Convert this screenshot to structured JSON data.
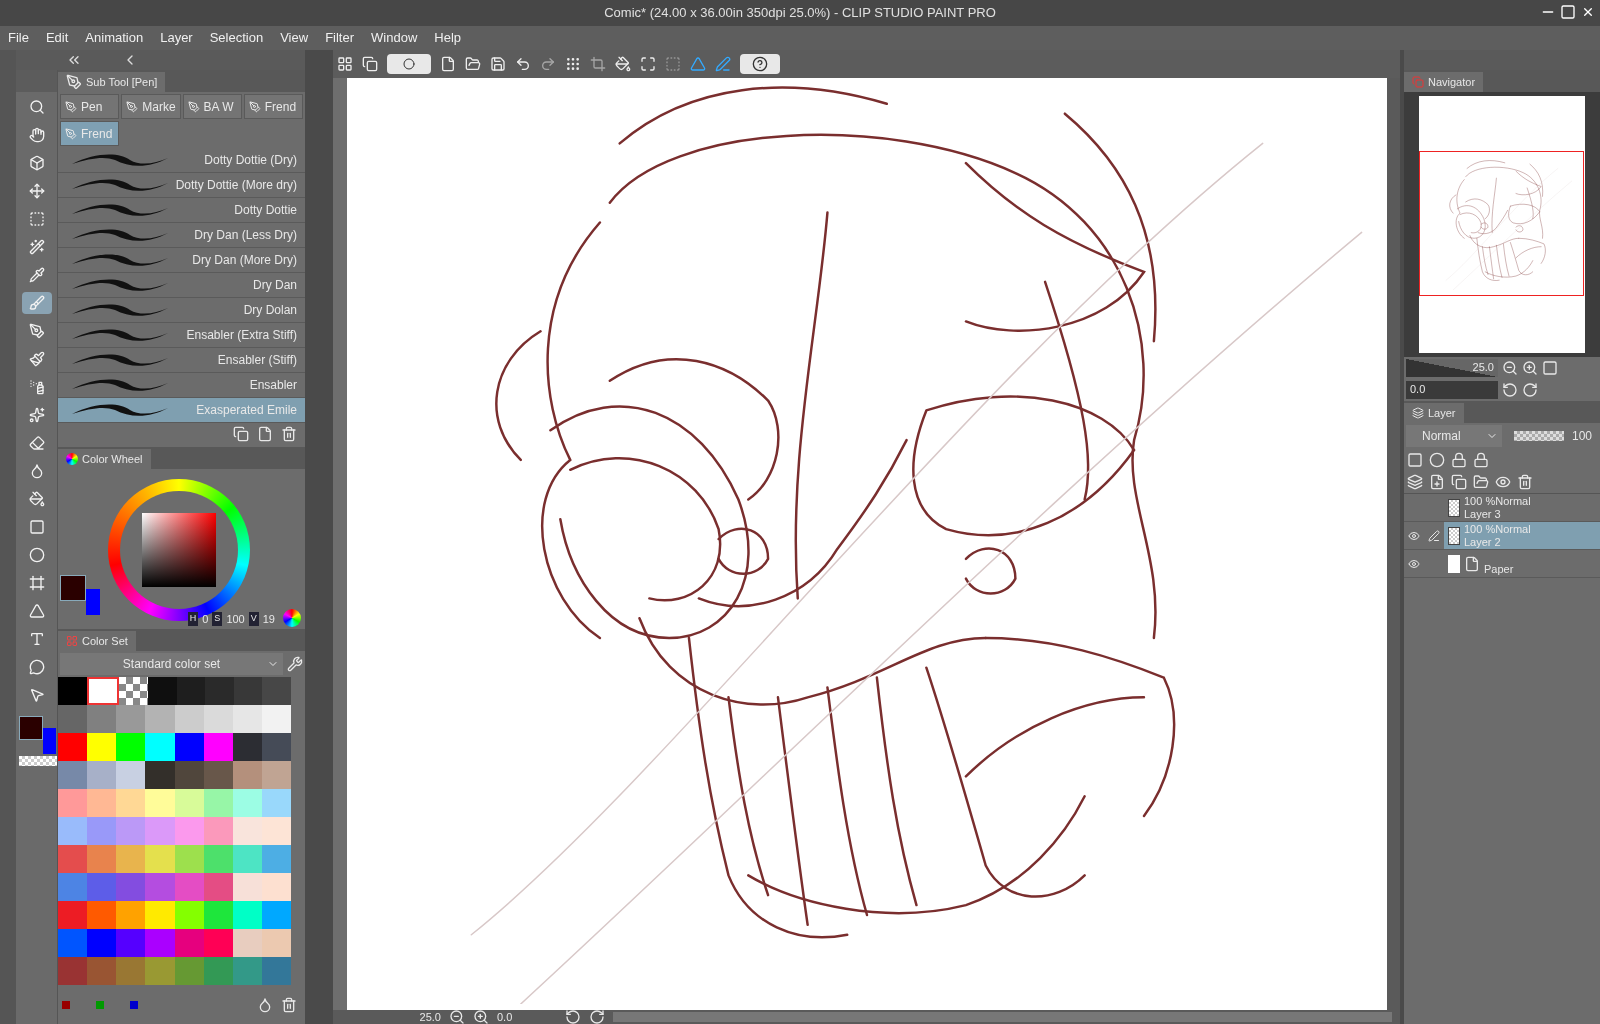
{
  "window": {
    "title": "Comic* (24.00 x 36.00in 350dpi 25.0%)  - CLIP STUDIO PAINT PRO"
  },
  "menu": [
    "File",
    "Edit",
    "Animation",
    "Layer",
    "Selection",
    "View",
    "Filter",
    "Window",
    "Help"
  ],
  "tools": [
    {
      "selected": false
    },
    {
      "selected": false
    },
    {
      "selected": false
    },
    {
      "selected": false
    },
    {
      "selected": false
    },
    {
      "selected": false
    },
    {
      "selected": false
    },
    {
      "selected": true
    },
    {
      "selected": false
    },
    {
      "selected": false
    },
    {
      "selected": false
    },
    {
      "selected": false
    },
    {
      "selected": false
    },
    {
      "selected": false
    },
    {
      "selected": false
    },
    {
      "selected": false
    },
    {
      "selected": false
    },
    {
      "selected": false
    },
    {
      "selected": false
    },
    {
      "selected": false
    },
    {
      "selected": false
    },
    {
      "selected": false
    }
  ],
  "sub_tool": {
    "title": "Sub Tool [Pen]",
    "groups": [
      {
        "label": "Pen",
        "selected": false
      },
      {
        "label": "Marke",
        "selected": false
      },
      {
        "label": "BA W",
        "selected": false
      },
      {
        "label": "Frend",
        "selected": false
      },
      {
        "label": "Frend",
        "selected": true
      }
    ],
    "brushes": [
      {
        "name": "Dotty Dottie (Dry)",
        "selected": false
      },
      {
        "name": "Dotty Dottie (More dry)",
        "selected": false
      },
      {
        "name": "Dotty Dottie",
        "selected": false
      },
      {
        "name": "Dry Dan (Less Dry)",
        "selected": false
      },
      {
        "name": "Dry Dan (More Dry)",
        "selected": false
      },
      {
        "name": "Dry Dan",
        "selected": false
      },
      {
        "name": "Dry Dolan",
        "selected": false
      },
      {
        "name": "Ensabler (Extra Stiff)",
        "selected": false
      },
      {
        "name": "Ensabler (Stiff)",
        "selected": false
      },
      {
        "name": "Ensabler",
        "selected": false
      },
      {
        "name": "Exasperated Emile",
        "selected": true
      }
    ]
  },
  "color_wheel": {
    "title": "Color Wheel",
    "h_label": "H",
    "h": "0",
    "s_label": "S",
    "s": "100",
    "v_label": "V",
    "v": "19"
  },
  "color_set": {
    "title": "Color Set",
    "set_name": "Standard color set",
    "swatches": [
      [
        {
          "color": "#000000",
          "selected": false
        },
        {
          "color": "#ffffff",
          "selected": true
        },
        {
          "kind": "transparent",
          "selected": false
        },
        {
          "color": "#0f0f0f",
          "selected": false
        },
        {
          "color": "#1e1e1e",
          "selected": false
        },
        {
          "color": "#2a2a2a",
          "selected": false
        },
        {
          "color": "#383838",
          "selected": false
        },
        {
          "color": "#474747",
          "selected": false
        }
      ],
      [
        {
          "color": "#666666",
          "selected": false
        },
        {
          "color": "#808080",
          "selected": false
        },
        {
          "color": "#999999",
          "selected": false
        },
        {
          "color": "#b3b3b3",
          "selected": false
        },
        {
          "color": "#cccccc",
          "selected": false
        },
        {
          "color": "#dadada",
          "selected": false
        },
        {
          "color": "#e6e6e6",
          "selected": false
        },
        {
          "color": "#f2f2f2",
          "selected": false
        }
      ],
      [
        {
          "color": "#ff0000",
          "selected": false
        },
        {
          "color": "#ffff00",
          "selected": false
        },
        {
          "color": "#00ff00",
          "selected": false
        },
        {
          "color": "#00ffff",
          "selected": false
        },
        {
          "color": "#0000ff",
          "selected": false
        },
        {
          "color": "#ff00ff",
          "selected": false
        },
        {
          "color": "#2c2d33",
          "selected": false
        },
        {
          "color": "#454b57",
          "selected": false
        }
      ],
      [
        {
          "color": "#7789a8",
          "selected": false
        },
        {
          "color": "#a7b0c8",
          "selected": false
        },
        {
          "color": "#c8d0e2",
          "selected": false
        },
        {
          "color": "#332f2a",
          "selected": false
        },
        {
          "color": "#50463c",
          "selected": false
        },
        {
          "color": "#68574a",
          "selected": false
        },
        {
          "color": "#b4907c",
          "selected": false
        },
        {
          "color": "#c0a493",
          "selected": false
        }
      ],
      [
        {
          "color": "#ff9999",
          "selected": false
        },
        {
          "color": "#ffb894",
          "selected": false
        },
        {
          "color": "#ffd895",
          "selected": false
        },
        {
          "color": "#fffc99",
          "selected": false
        },
        {
          "color": "#d8fb99",
          "selected": false
        },
        {
          "color": "#97f6a7",
          "selected": false
        },
        {
          "color": "#9cfde4",
          "selected": false
        },
        {
          "color": "#99d8fb",
          "selected": false
        }
      ],
      [
        {
          "color": "#99bbfb",
          "selected": false
        },
        {
          "color": "#9999f9",
          "selected": false
        },
        {
          "color": "#bb99f7",
          "selected": false
        },
        {
          "color": "#db99f9",
          "selected": false
        },
        {
          "color": "#fb99ed",
          "selected": false
        },
        {
          "color": "#fb99bb",
          "selected": false
        },
        {
          "color": "#f9e4dc",
          "selected": false
        },
        {
          "color": "#fde4d6",
          "selected": false
        }
      ],
      [
        {
          "color": "#e44d4d",
          "selected": false
        },
        {
          "color": "#e8834d",
          "selected": false
        },
        {
          "color": "#e8b44d",
          "selected": false
        },
        {
          "color": "#e4e04d",
          "selected": false
        },
        {
          "color": "#9de04d",
          "selected": false
        },
        {
          "color": "#4de06b",
          "selected": false
        },
        {
          "color": "#4de4c4",
          "selected": false
        },
        {
          "color": "#4daee4",
          "selected": false
        }
      ],
      [
        {
          "color": "#4d84e4",
          "selected": false
        },
        {
          "color": "#5d5de8",
          "selected": false
        },
        {
          "color": "#834de0",
          "selected": false
        },
        {
          "color": "#b44de0",
          "selected": false
        },
        {
          "color": "#e44dc4",
          "selected": false
        },
        {
          "color": "#e44d84",
          "selected": false
        },
        {
          "color": "#f7e0d8",
          "selected": false
        },
        {
          "color": "#fde0d0",
          "selected": false
        }
      ],
      [
        {
          "color": "#ed1c24",
          "selected": false
        },
        {
          "color": "#ff5a00",
          "selected": false
        },
        {
          "color": "#ffa200",
          "selected": false
        },
        {
          "color": "#ffea00",
          "selected": false
        },
        {
          "color": "#84ff00",
          "selected": false
        },
        {
          "color": "#1ee63c",
          "selected": false
        },
        {
          "color": "#00ffc6",
          "selected": false
        },
        {
          "color": "#00a8ff",
          "selected": false
        }
      ],
      [
        {
          "color": "#0055ff",
          "selected": false
        },
        {
          "color": "#0000ff",
          "selected": false
        },
        {
          "color": "#5500ff",
          "selected": false
        },
        {
          "color": "#aa00ff",
          "selected": false
        },
        {
          "color": "#e6007e",
          "selected": false
        },
        {
          "color": "#ff0055",
          "selected": false
        },
        {
          "color": "#e8cdbf",
          "selected": false
        },
        {
          "color": "#ecc9b0",
          "selected": false
        }
      ],
      [
        {
          "color": "#993333",
          "selected": false
        },
        {
          "color": "#995533",
          "selected": false
        },
        {
          "color": "#997733",
          "selected": false
        },
        {
          "color": "#999933",
          "selected": false
        },
        {
          "color": "#669933",
          "selected": false
        },
        {
          "color": "#339955",
          "selected": false
        },
        {
          "color": "#339988",
          "selected": false
        },
        {
          "color": "#337799",
          "selected": false
        }
      ]
    ],
    "recent": [
      {
        "color": "#990000"
      },
      {
        "color": "#009900"
      },
      {
        "color": "#0000cc"
      }
    ]
  },
  "status_bar": {
    "zoom": "25.0",
    "rotation": "0.0"
  },
  "navigator": {
    "title": "Navigator",
    "zoom": "25.0",
    "rotation": "0.0"
  },
  "layer_panel": {
    "title": "Layer",
    "blend_mode": "Normal",
    "opacity": "100",
    "opacity_slider": {
      "level": 1
    },
    "layers": [
      {
        "kind": "raster",
        "mode": "100 %Normal",
        "name": "Layer 3",
        "visible": false,
        "editing": false,
        "selected": false
      },
      {
        "kind": "raster",
        "mode": "100 %Normal",
        "name": "Layer 2",
        "visible": true,
        "editing": true,
        "selected": true
      },
      {
        "kind": "paper",
        "name": "Paper",
        "visible": true,
        "editing": false,
        "selected": false
      }
    ]
  }
}
